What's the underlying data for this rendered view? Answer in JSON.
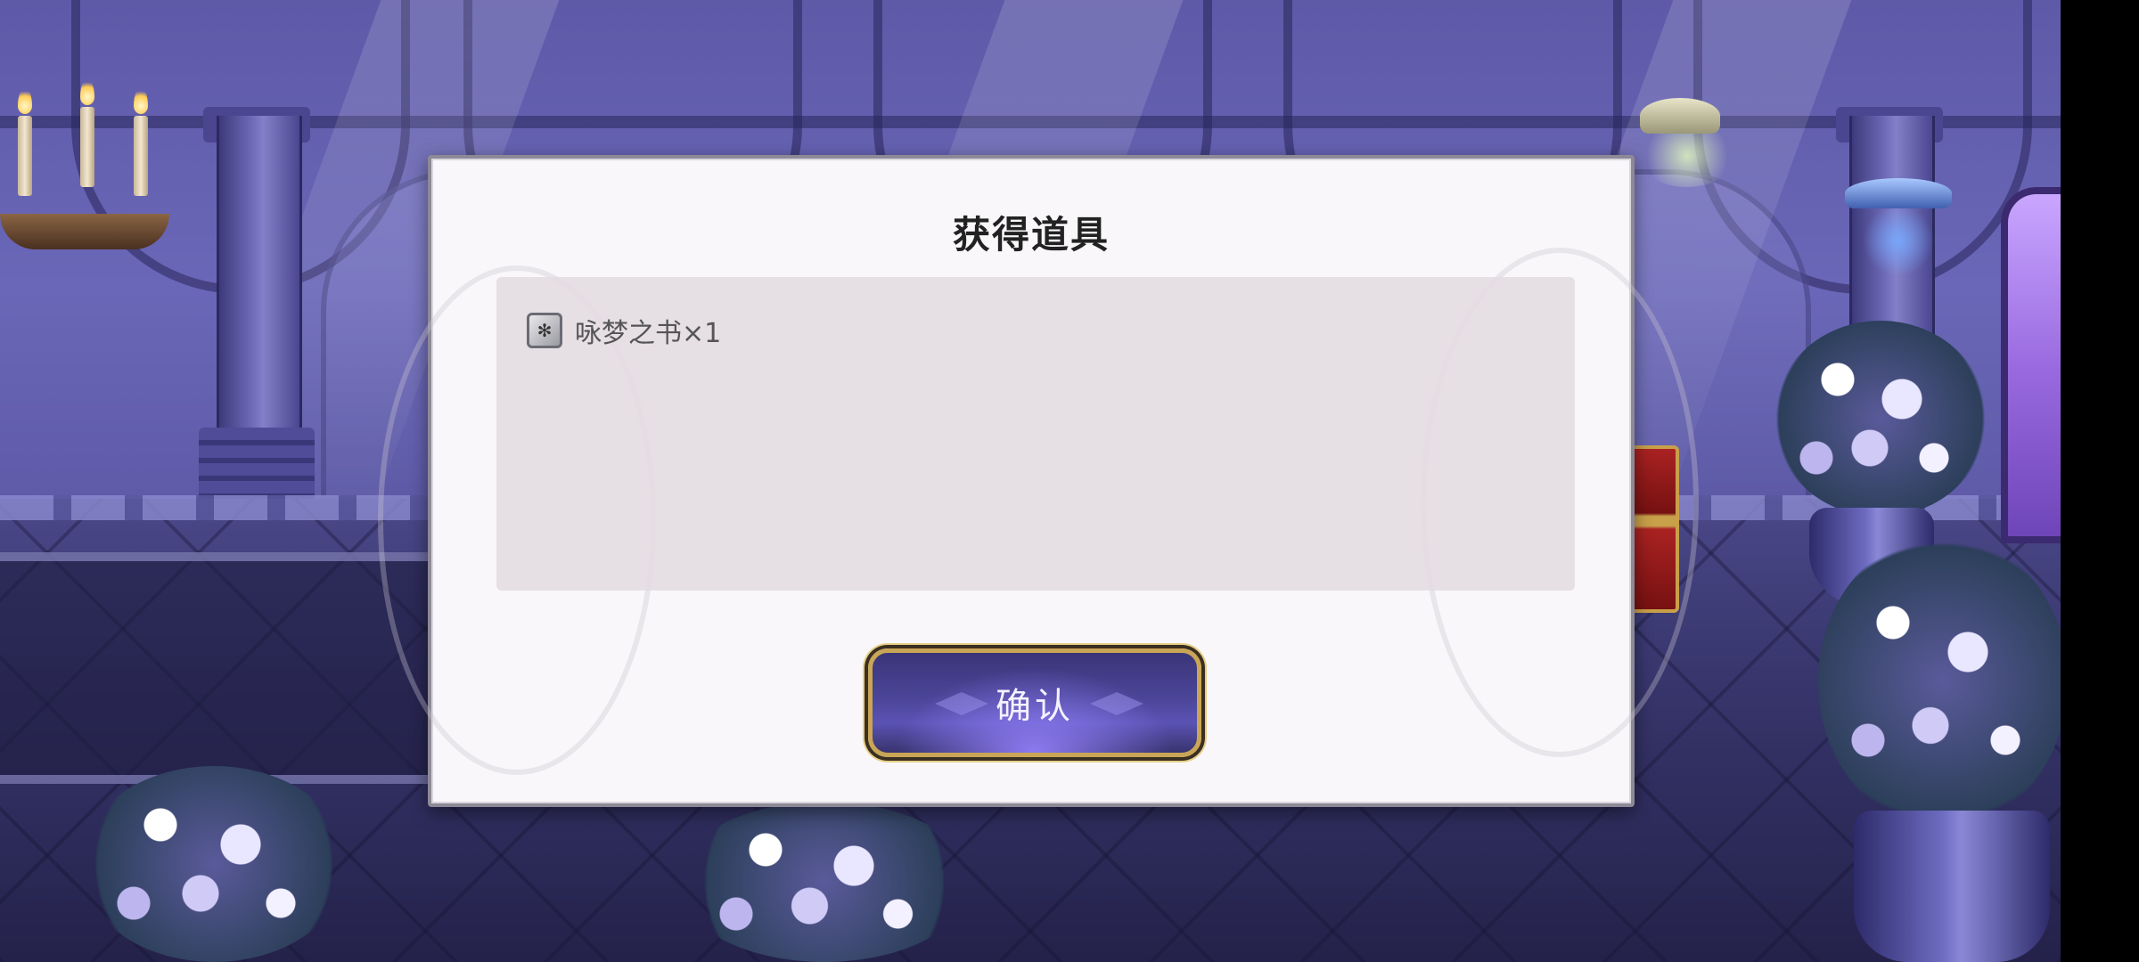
{
  "dialog": {
    "title": "获得道具",
    "items": [
      {
        "icon": "book-icon",
        "label": "咏梦之书×1"
      }
    ],
    "confirm_label": "确认"
  },
  "colors": {
    "dialog_bg": "#f9f7f9",
    "panel_bg": "#e4dce2",
    "button_border": "#c9a556",
    "button_fill": "#4b4598"
  }
}
